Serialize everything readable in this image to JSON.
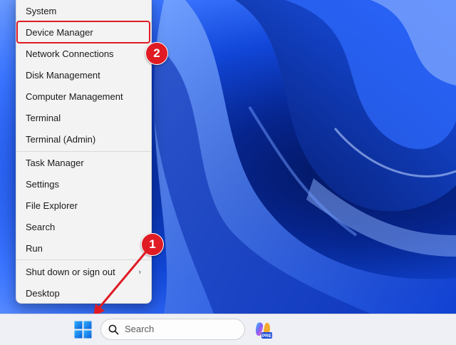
{
  "menu": {
    "items": [
      {
        "label": "System"
      },
      {
        "label": "Device Manager"
      },
      {
        "label": "Network Connections"
      },
      {
        "label": "Disk Management"
      },
      {
        "label": "Computer Management"
      },
      {
        "label": "Terminal"
      },
      {
        "label": "Terminal (Admin)"
      },
      {
        "label": "Task Manager"
      },
      {
        "label": "Settings"
      },
      {
        "label": "File Explorer"
      },
      {
        "label": "Search"
      },
      {
        "label": "Run"
      },
      {
        "label": "Shut down or sign out",
        "submenu_glyph": "›"
      },
      {
        "label": "Desktop"
      }
    ]
  },
  "annotations": {
    "step1": "1",
    "step2": "2",
    "color": "#e01b24"
  },
  "taskbar": {
    "search_placeholder": "Search",
    "copilot_badge": "PRE"
  },
  "icons": {
    "start": "windows-start-icon",
    "search": "search-icon",
    "copilot": "copilot-icon",
    "chevron": "chevron-right-icon"
  }
}
